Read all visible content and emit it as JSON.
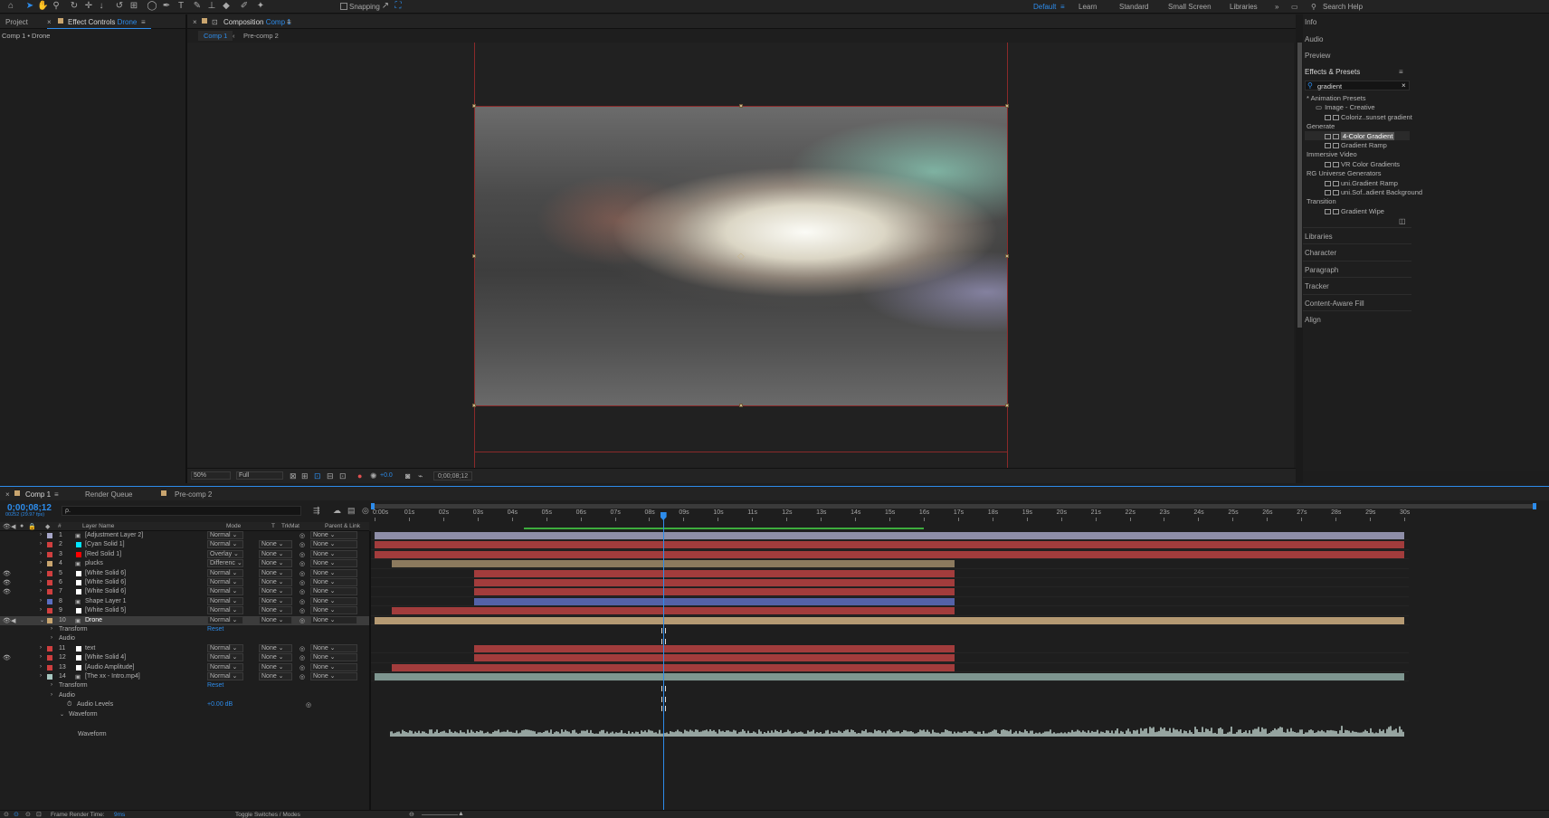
{
  "toolbar": {
    "snapping_label": "Snapping",
    "workspaces": [
      "Default",
      "Learn",
      "Standard",
      "Small Screen",
      "Libraries"
    ],
    "search_placeholder": "Search Help"
  },
  "left_panel": {
    "tab_project": "Project",
    "tab_effect_controls": "Effect Controls",
    "tab_effect_controls_target": "Drone",
    "breadcrumb": "Comp 1 • Drone"
  },
  "composition_panel": {
    "tab_label": "Composition",
    "tab_comp_name": "Comp 1",
    "sub_tabs": [
      "Comp 1",
      "Pre-comp 2"
    ],
    "zoom": "50%",
    "resolution": "Full",
    "exposure": "+0.0",
    "timecode": "0;00;08;12"
  },
  "right_panel": {
    "top_items": [
      "Info",
      "Audio",
      "Preview",
      "Effects & Presets"
    ],
    "search_value": "gradient",
    "tree": [
      {
        "label": "* Animation Presets",
        "indent": 0,
        "fx": false
      },
      {
        "label": "Image - Creative",
        "indent": 1,
        "fx": false
      },
      {
        "label": "Coloriz..sunset gradient",
        "indent": 2,
        "fx": true
      },
      {
        "label": "Generate",
        "indent": 0,
        "fx": false
      },
      {
        "label": "4-Color Gradient",
        "indent": 2,
        "fx": true,
        "selected": true
      },
      {
        "label": "Gradient Ramp",
        "indent": 2,
        "fx": true
      },
      {
        "label": "Immersive Video",
        "indent": 0,
        "fx": false
      },
      {
        "label": "VR Color Gradients",
        "indent": 2,
        "fx": true
      },
      {
        "label": "RG Universe Generators",
        "indent": 0,
        "fx": false
      },
      {
        "label": "uni.Gradient Ramp",
        "indent": 2,
        "fx": true
      },
      {
        "label": "uni.Sof..adient Background",
        "indent": 2,
        "fx": true
      },
      {
        "label": "Transition",
        "indent": 0,
        "fx": false
      },
      {
        "label": "Gradient Wipe",
        "indent": 2,
        "fx": true
      }
    ],
    "bottom_items": [
      "Libraries",
      "Character",
      "Paragraph",
      "Tracker",
      "Content-Aware Fill",
      "Align"
    ]
  },
  "timeline": {
    "tabs": [
      "Comp 1",
      "Render Queue",
      "Pre-comp 2"
    ],
    "current_time": "0;00;08;12",
    "frame_info": "00252 (29.97 fps)",
    "search_placeholder": "ρ.",
    "columns": {
      "name": "Layer Name",
      "mode": "Mode",
      "t": "T",
      "trkmat": "TrkMat",
      "parent": "Parent & Link",
      "hash": "#"
    },
    "ruler": [
      "0:00s",
      "01s",
      "02s",
      "03s",
      "04s",
      "05s",
      "06s",
      "07s",
      "08s",
      "09s",
      "10s",
      "11s",
      "12s",
      "13s",
      "14s",
      "15s",
      "16s",
      "17s",
      "18s",
      "19s",
      "20s",
      "21s",
      "22s",
      "23s",
      "24s",
      "25s",
      "26s",
      "27s",
      "28s",
      "29s",
      "30s"
    ],
    "playhead_seconds": 8.4,
    "duration_seconds": 30,
    "layers": [
      {
        "num": "1",
        "name": "[Adjustment Layer 2]",
        "color": "#a6a6c8",
        "mode": "Normal",
        "trkmat": "",
        "parent": "None",
        "eye": false,
        "bar": {
          "start": 0,
          "end": 30,
          "color": "#8e8ea8"
        }
      },
      {
        "num": "2",
        "name": "[Cyan Solid 1]",
        "color": "#cf3f3f",
        "icon": "#00e5ff",
        "mode": "Normal",
        "trkmat": "None",
        "parent": "None",
        "eye": false,
        "bar": {
          "start": 0,
          "end": 30,
          "color": "#a23c3c"
        }
      },
      {
        "num": "3",
        "name": "[Red Solid 1]",
        "color": "#cf3f3f",
        "icon": "#ff0000",
        "mode": "Overlay",
        "trkmat": "None",
        "parent": "None",
        "eye": false,
        "bar": {
          "start": 0,
          "end": 30,
          "color": "#a23c3c"
        }
      },
      {
        "num": "4",
        "name": "plucks",
        "color": "#c9a56f",
        "mode": "Differenc",
        "trkmat": "None",
        "parent": "None",
        "eye": false,
        "bar": {
          "start": 0.5,
          "end": 16.9,
          "color": "#8c7a5e"
        }
      },
      {
        "num": "5",
        "name": "[White Solid 6]",
        "color": "#cf3f3f",
        "icon": "#ffffff",
        "mode": "Normal",
        "trkmat": "None",
        "parent": "None",
        "eye": true,
        "bar": {
          "start": 2.9,
          "end": 16.9,
          "color": "#a23c3c"
        }
      },
      {
        "num": "6",
        "name": "[White Solid 6]",
        "color": "#cf3f3f",
        "icon": "#ffffff",
        "mode": "Normal",
        "trkmat": "None",
        "parent": "None",
        "eye": true,
        "bar": {
          "start": 2.9,
          "end": 16.9,
          "color": "#a23c3c"
        }
      },
      {
        "num": "7",
        "name": "[White Solid 6]",
        "color": "#cf3f3f",
        "icon": "#ffffff",
        "mode": "Normal",
        "trkmat": "None",
        "parent": "None",
        "eye": true,
        "bar": {
          "start": 2.9,
          "end": 16.9,
          "color": "#a23c3c"
        }
      },
      {
        "num": "8",
        "name": "Shape Layer 1",
        "color": "#5a6ec0",
        "mode": "Normal",
        "trkmat": "None",
        "parent": "None",
        "eye": false,
        "bar": {
          "start": 2.9,
          "end": 16.9,
          "color": "#5462a8"
        }
      },
      {
        "num": "9",
        "name": "[White Solid 5]",
        "color": "#cf3f3f",
        "icon": "#ffffff",
        "mode": "Normal",
        "trkmat": "None",
        "parent": "None",
        "eye": false,
        "bar": {
          "start": 0.5,
          "end": 16.9,
          "color": "#a23c3c"
        }
      },
      {
        "num": "10",
        "name": "Drone",
        "color": "#c9a56f",
        "mode": "Normal",
        "trkmat": "None",
        "parent": "None",
        "eye": true,
        "selected": true,
        "bar": {
          "start": 0,
          "end": 30,
          "color": "#b59a73"
        }
      },
      {
        "sub": "Transform",
        "reset": "Reset"
      },
      {
        "sub": "Audio"
      },
      {
        "num": "11",
        "name": "text",
        "color": "#cf3f3f",
        "icon": "#ffffff",
        "mode": "Normal",
        "trkmat": "None",
        "parent": "None",
        "eye": false,
        "bar": {
          "start": 2.9,
          "end": 16.9,
          "color": "#a23c3c"
        }
      },
      {
        "num": "12",
        "name": "[White Solid 4]",
        "color": "#cf3f3f",
        "icon": "#ffffff",
        "mode": "Normal",
        "trkmat": "None",
        "parent": "None",
        "eye": true,
        "bar": {
          "start": 2.9,
          "end": 16.9,
          "color": "#a23c3c"
        }
      },
      {
        "num": "13",
        "name": "[Audio Amplitude]",
        "color": "#cf3f3f",
        "icon": "#ffffff",
        "mode": "Normal",
        "trkmat": "None",
        "parent": "None",
        "eye": false,
        "bar": {
          "start": 0.5,
          "end": 16.9,
          "color": "#a23c3c"
        }
      },
      {
        "num": "14",
        "name": "[The xx - Intro.mp4]",
        "color": "#a7c7c0",
        "mode": "Normal",
        "trkmat": "None",
        "parent": "None",
        "eye": false,
        "bar": {
          "start": 0,
          "end": 30,
          "color": "#7e9690"
        }
      },
      {
        "sub": "Transform",
        "reset": "Reset"
      },
      {
        "sub": "Audio"
      },
      {
        "sub2": "Audio Levels",
        "value": "+0.00 dB"
      },
      {
        "sub2": "Waveform"
      },
      {
        "sub3": "Waveform"
      }
    ],
    "footer_render_label": "Frame Render Time:",
    "footer_render_value": "9ms",
    "footer_toggle": "Toggle Switches / Modes"
  }
}
